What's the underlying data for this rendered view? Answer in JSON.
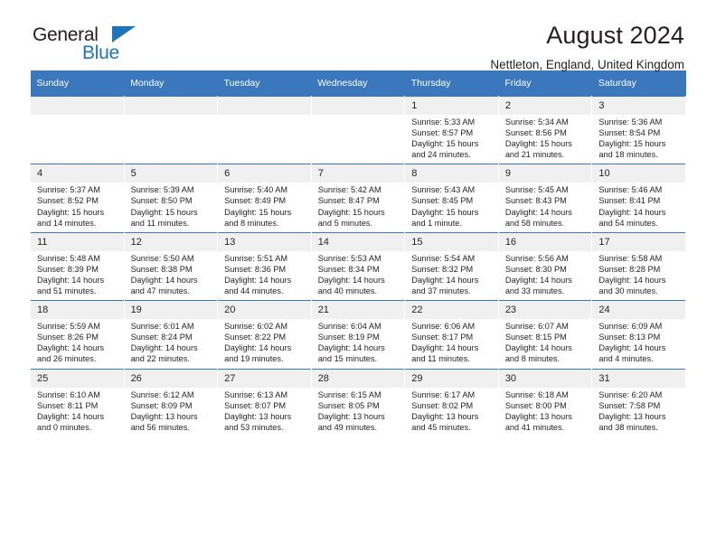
{
  "brand": {
    "name_part1": "General",
    "name_part2": "Blue",
    "triangle_color": "#1b75bb",
    "text_color": "#231f20"
  },
  "header": {
    "title": "August 2024",
    "subtitle": "Nettleton, England, United Kingdom"
  },
  "theme": {
    "header_row_bg": "#3b77bc",
    "header_row_text": "#ffffff",
    "daynum_bg": "#f0f0f0",
    "grid_line": "#3b77bc"
  },
  "weekdays": [
    "Sunday",
    "Monday",
    "Tuesday",
    "Wednesday",
    "Thursday",
    "Friday",
    "Saturday"
  ],
  "labels": {
    "sunrise_prefix": "Sunrise:",
    "sunset_prefix": "Sunset:",
    "daylight_prefix": "Daylight:"
  },
  "weeks": [
    [
      {
        "day": "",
        "empty": true
      },
      {
        "day": "",
        "empty": true
      },
      {
        "day": "",
        "empty": true
      },
      {
        "day": "",
        "empty": true
      },
      {
        "day": "1",
        "sunrise": "Sunrise: 5:33 AM",
        "sunset": "Sunset: 8:57 PM",
        "daylight_line1": "Daylight: 15 hours",
        "daylight_line2": "and 24 minutes."
      },
      {
        "day": "2",
        "sunrise": "Sunrise: 5:34 AM",
        "sunset": "Sunset: 8:56 PM",
        "daylight_line1": "Daylight: 15 hours",
        "daylight_line2": "and 21 minutes."
      },
      {
        "day": "3",
        "sunrise": "Sunrise: 5:36 AM",
        "sunset": "Sunset: 8:54 PM",
        "daylight_line1": "Daylight: 15 hours",
        "daylight_line2": "and 18 minutes."
      }
    ],
    [
      {
        "day": "4",
        "sunrise": "Sunrise: 5:37 AM",
        "sunset": "Sunset: 8:52 PM",
        "daylight_line1": "Daylight: 15 hours",
        "daylight_line2": "and 14 minutes."
      },
      {
        "day": "5",
        "sunrise": "Sunrise: 5:39 AM",
        "sunset": "Sunset: 8:50 PM",
        "daylight_line1": "Daylight: 15 hours",
        "daylight_line2": "and 11 minutes."
      },
      {
        "day": "6",
        "sunrise": "Sunrise: 5:40 AM",
        "sunset": "Sunset: 8:49 PM",
        "daylight_line1": "Daylight: 15 hours",
        "daylight_line2": "and 8 minutes."
      },
      {
        "day": "7",
        "sunrise": "Sunrise: 5:42 AM",
        "sunset": "Sunset: 8:47 PM",
        "daylight_line1": "Daylight: 15 hours",
        "daylight_line2": "and 5 minutes."
      },
      {
        "day": "8",
        "sunrise": "Sunrise: 5:43 AM",
        "sunset": "Sunset: 8:45 PM",
        "daylight_line1": "Daylight: 15 hours",
        "daylight_line2": "and 1 minute."
      },
      {
        "day": "9",
        "sunrise": "Sunrise: 5:45 AM",
        "sunset": "Sunset: 8:43 PM",
        "daylight_line1": "Daylight: 14 hours",
        "daylight_line2": "and 58 minutes."
      },
      {
        "day": "10",
        "sunrise": "Sunrise: 5:46 AM",
        "sunset": "Sunset: 8:41 PM",
        "daylight_line1": "Daylight: 14 hours",
        "daylight_line2": "and 54 minutes."
      }
    ],
    [
      {
        "day": "11",
        "sunrise": "Sunrise: 5:48 AM",
        "sunset": "Sunset: 8:39 PM",
        "daylight_line1": "Daylight: 14 hours",
        "daylight_line2": "and 51 minutes."
      },
      {
        "day": "12",
        "sunrise": "Sunrise: 5:50 AM",
        "sunset": "Sunset: 8:38 PM",
        "daylight_line1": "Daylight: 14 hours",
        "daylight_line2": "and 47 minutes."
      },
      {
        "day": "13",
        "sunrise": "Sunrise: 5:51 AM",
        "sunset": "Sunset: 8:36 PM",
        "daylight_line1": "Daylight: 14 hours",
        "daylight_line2": "and 44 minutes."
      },
      {
        "day": "14",
        "sunrise": "Sunrise: 5:53 AM",
        "sunset": "Sunset: 8:34 PM",
        "daylight_line1": "Daylight: 14 hours",
        "daylight_line2": "and 40 minutes."
      },
      {
        "day": "15",
        "sunrise": "Sunrise: 5:54 AM",
        "sunset": "Sunset: 8:32 PM",
        "daylight_line1": "Daylight: 14 hours",
        "daylight_line2": "and 37 minutes."
      },
      {
        "day": "16",
        "sunrise": "Sunrise: 5:56 AM",
        "sunset": "Sunset: 8:30 PM",
        "daylight_line1": "Daylight: 14 hours",
        "daylight_line2": "and 33 minutes."
      },
      {
        "day": "17",
        "sunrise": "Sunrise: 5:58 AM",
        "sunset": "Sunset: 8:28 PM",
        "daylight_line1": "Daylight: 14 hours",
        "daylight_line2": "and 30 minutes."
      }
    ],
    [
      {
        "day": "18",
        "sunrise": "Sunrise: 5:59 AM",
        "sunset": "Sunset: 8:26 PM",
        "daylight_line1": "Daylight: 14 hours",
        "daylight_line2": "and 26 minutes."
      },
      {
        "day": "19",
        "sunrise": "Sunrise: 6:01 AM",
        "sunset": "Sunset: 8:24 PM",
        "daylight_line1": "Daylight: 14 hours",
        "daylight_line2": "and 22 minutes."
      },
      {
        "day": "20",
        "sunrise": "Sunrise: 6:02 AM",
        "sunset": "Sunset: 8:22 PM",
        "daylight_line1": "Daylight: 14 hours",
        "daylight_line2": "and 19 minutes."
      },
      {
        "day": "21",
        "sunrise": "Sunrise: 6:04 AM",
        "sunset": "Sunset: 8:19 PM",
        "daylight_line1": "Daylight: 14 hours",
        "daylight_line2": "and 15 minutes."
      },
      {
        "day": "22",
        "sunrise": "Sunrise: 6:06 AM",
        "sunset": "Sunset: 8:17 PM",
        "daylight_line1": "Daylight: 14 hours",
        "daylight_line2": "and 11 minutes."
      },
      {
        "day": "23",
        "sunrise": "Sunrise: 6:07 AM",
        "sunset": "Sunset: 8:15 PM",
        "daylight_line1": "Daylight: 14 hours",
        "daylight_line2": "and 8 minutes."
      },
      {
        "day": "24",
        "sunrise": "Sunrise: 6:09 AM",
        "sunset": "Sunset: 8:13 PM",
        "daylight_line1": "Daylight: 14 hours",
        "daylight_line2": "and 4 minutes."
      }
    ],
    [
      {
        "day": "25",
        "sunrise": "Sunrise: 6:10 AM",
        "sunset": "Sunset: 8:11 PM",
        "daylight_line1": "Daylight: 14 hours",
        "daylight_line2": "and 0 minutes."
      },
      {
        "day": "26",
        "sunrise": "Sunrise: 6:12 AM",
        "sunset": "Sunset: 8:09 PM",
        "daylight_line1": "Daylight: 13 hours",
        "daylight_line2": "and 56 minutes."
      },
      {
        "day": "27",
        "sunrise": "Sunrise: 6:13 AM",
        "sunset": "Sunset: 8:07 PM",
        "daylight_line1": "Daylight: 13 hours",
        "daylight_line2": "and 53 minutes."
      },
      {
        "day": "28",
        "sunrise": "Sunrise: 6:15 AM",
        "sunset": "Sunset: 8:05 PM",
        "daylight_line1": "Daylight: 13 hours",
        "daylight_line2": "and 49 minutes."
      },
      {
        "day": "29",
        "sunrise": "Sunrise: 6:17 AM",
        "sunset": "Sunset: 8:02 PM",
        "daylight_line1": "Daylight: 13 hours",
        "daylight_line2": "and 45 minutes."
      },
      {
        "day": "30",
        "sunrise": "Sunrise: 6:18 AM",
        "sunset": "Sunset: 8:00 PM",
        "daylight_line1": "Daylight: 13 hours",
        "daylight_line2": "and 41 minutes."
      },
      {
        "day": "31",
        "sunrise": "Sunrise: 6:20 AM",
        "sunset": "Sunset: 7:58 PM",
        "daylight_line1": "Daylight: 13 hours",
        "daylight_line2": "and 38 minutes."
      }
    ]
  ]
}
